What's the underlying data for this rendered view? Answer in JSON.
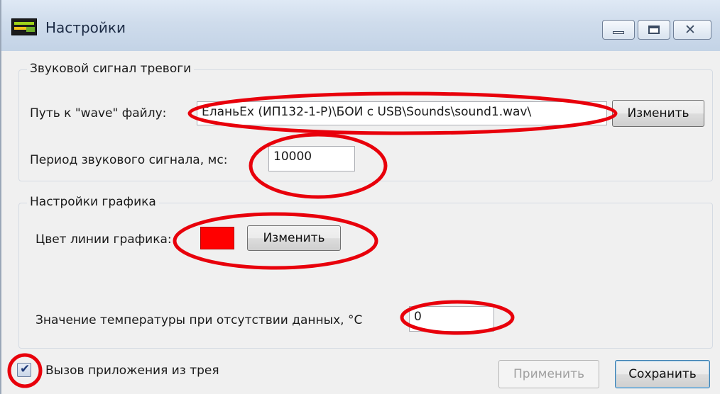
{
  "window": {
    "title": "Настройки"
  },
  "sound_alarm": {
    "legend": "Звуковой сигнал тревоги",
    "wave_path_label": "Путь к \"wave\" файлу:",
    "wave_path_value": "\\ЕланьEx (ИП132-1-P)\\БОИ с USB\\Sounds\\sound1.wav",
    "change_label": "Изменить",
    "period_label": "Период звукового сигнала, мс:",
    "period_value": "10000"
  },
  "graph_settings": {
    "legend": "Настройки графика",
    "line_color_label": "Цвет линии графика:",
    "line_color": "#ff0000",
    "change_label": "Изменить",
    "no_data_temp_label": "Значение температуры при отсутствии данных, °C",
    "no_data_temp_value": "0"
  },
  "footer": {
    "tray_checkbox_label": "Вызов приложения из трея",
    "tray_checkbox_checked": true,
    "apply_label": "Применить",
    "save_label": "Сохранить"
  },
  "icons": {
    "app": "app-icon",
    "minimize": "minimize-icon",
    "maximize": "maximize-icon",
    "close": "close-icon",
    "check": "checkmark-icon"
  },
  "annotation_color": "#e8000b"
}
